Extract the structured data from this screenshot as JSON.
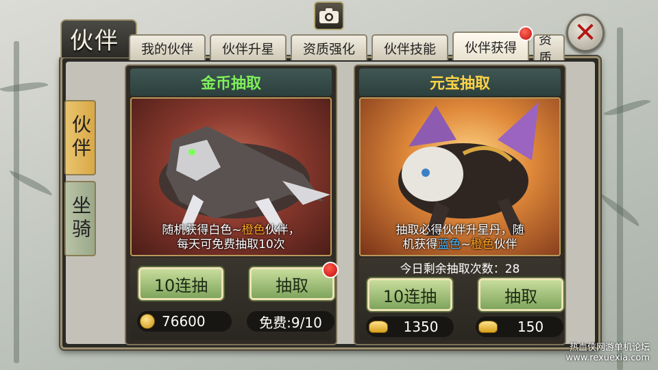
{
  "window": {
    "title": "伙伴"
  },
  "tabs": [
    {
      "label": "我的伙伴"
    },
    {
      "label": "伙伴升星"
    },
    {
      "label": "资质强化"
    },
    {
      "label": "伙伴技能"
    },
    {
      "label": "伙伴获得",
      "active": true
    },
    {
      "label": "资质"
    }
  ],
  "side_tabs": [
    {
      "label": "伙伴",
      "active": true
    },
    {
      "label": "坐骑"
    }
  ],
  "gold_draw": {
    "title": "金币抽取",
    "title_color": "#7ff05a",
    "caption_line1_a": "随机获得白色~",
    "caption_line1_b": "橙色",
    "caption_line1_c": "伙伴，",
    "caption_line2": "每天可免费抽取10次",
    "btn_ten": "10连抽",
    "btn_one": "抽取",
    "coins": "76600",
    "free_text": "免费:9/10"
  },
  "ingot_draw": {
    "title": "元宝抽取",
    "title_color": "#ffd447",
    "caption_line1": "抽取必得伙伴升星丹，随",
    "caption_line2_a": "机获得",
    "caption_line2_b": "蓝色",
    "caption_line2_c": "~",
    "caption_line2_d": "橙色",
    "caption_line2_e": "伙伴",
    "remaining": "今日剩余抽取次数：28",
    "btn_ten": "10连抽",
    "btn_one": "抽取",
    "cost_ten": "1350",
    "cost_one": "150"
  },
  "colors": {
    "orange": "#ffa321",
    "blue": "#41b4ff"
  },
  "watermark": {
    "line1": "热血侠网游单机论坛",
    "line2": "www.rexuexia.com"
  }
}
